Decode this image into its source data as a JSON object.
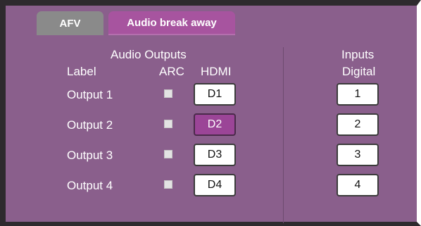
{
  "tabs": [
    {
      "label": "AFV",
      "active": false
    },
    {
      "label": "Audio break away",
      "active": true
    }
  ],
  "outputs_panel": {
    "title": "Audio Outputs",
    "col_label": "Label",
    "col_arc": "ARC",
    "col_hdmi": "HDMI",
    "rows": [
      {
        "label": "Output 1",
        "arc_checked": false,
        "hdmi": "D1",
        "selected": false
      },
      {
        "label": "Output 2",
        "arc_checked": false,
        "hdmi": "D2",
        "selected": true
      },
      {
        "label": "Output 3",
        "arc_checked": false,
        "hdmi": "D3",
        "selected": false
      },
      {
        "label": "Output 4",
        "arc_checked": false,
        "hdmi": "D4",
        "selected": false
      }
    ]
  },
  "inputs_panel": {
    "title": "Inputs",
    "subtitle": "Digital",
    "buttons": [
      "1",
      "2",
      "3",
      "4"
    ]
  },
  "colors": {
    "panel_bg": "#8a5f8c",
    "active_tab": "#a7549f",
    "inactive_tab": "#8a8a8a",
    "selected_button": "#9b4597"
  }
}
